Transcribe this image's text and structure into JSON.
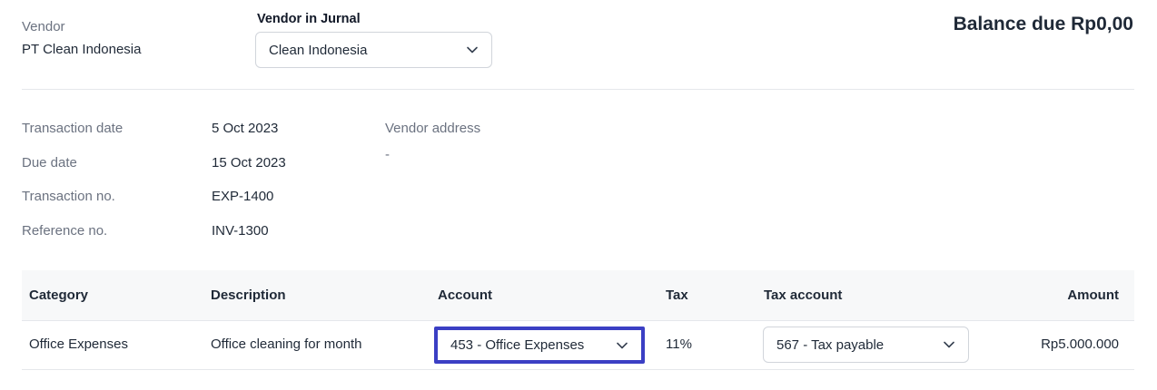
{
  "vendor": {
    "label": "Vendor",
    "name": "PT Clean Indonesia"
  },
  "jurnal": {
    "label": "Vendor in Jurnal",
    "selected": "Clean Indonesia"
  },
  "balance": {
    "text": "Balance due Rp0,00"
  },
  "details": {
    "transaction_date_label": "Transaction date",
    "transaction_date": "5 Oct 2023",
    "due_date_label": "Due date",
    "due_date": "15 Oct 2023",
    "transaction_no_label": "Transaction no.",
    "transaction_no": "EXP-1400",
    "reference_no_label": "Reference no.",
    "reference_no": "INV-1300",
    "vendor_address_label": "Vendor address",
    "vendor_address": "-"
  },
  "table": {
    "headers": {
      "category": "Category",
      "description": "Description",
      "account": "Account",
      "tax": "Tax",
      "tax_account": "Tax account",
      "amount": "Amount"
    },
    "rows": [
      {
        "category": "Office Expenses",
        "description": "Office cleaning for month",
        "account": "453 - Office Expenses",
        "tax": "11%",
        "tax_account": "567 - Tax payable",
        "amount": "Rp5.000.000"
      }
    ]
  },
  "colors": {
    "highlight_border": "#3b3fc4",
    "header_bg": "#f7f8f9"
  },
  "icons": {
    "dropdown": "chevron-down-icon"
  }
}
